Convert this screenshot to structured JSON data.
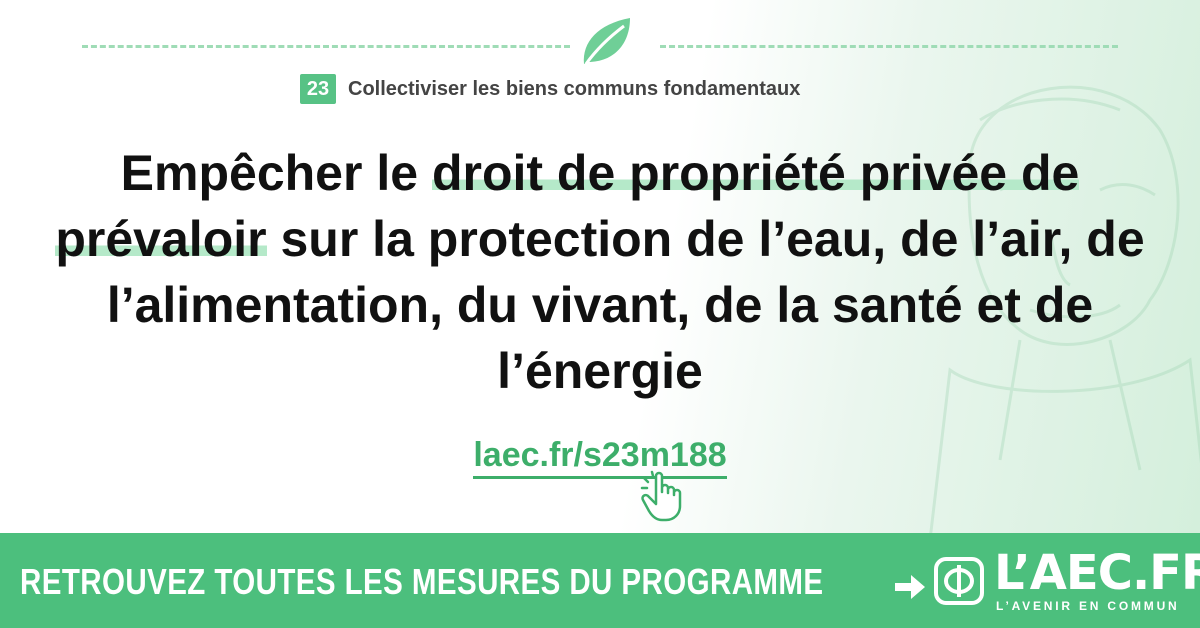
{
  "header": {
    "measure_number": "23",
    "category": "Collectiviser les biens communs fondamentaux"
  },
  "headline": {
    "part1": "Empêcher le ",
    "highlight1": "droit de propriété privée de",
    "line_break_highlight": "prévaloir",
    "part2": " sur la protection de l’eau, de l’air, de l’alimentation, du vivant, de la santé et de l’énergie"
  },
  "link": {
    "text": "laec.fr/s23m188"
  },
  "footer": {
    "cta": "RETROUVEZ TOUTES LES MESURES DU PROGRAMME",
    "logo_text": "L’AEC.FR",
    "logo_subtitle": "L’AVENIR EN COMMUN"
  },
  "colors": {
    "accent": "#4cbf7d",
    "link": "#3dae6a",
    "highlight": "#b5e9c9",
    "text": "#111111"
  },
  "icons": [
    "leaf-icon",
    "pointer-hand-icon",
    "arrow-right-icon",
    "phi-logo-icon"
  ]
}
